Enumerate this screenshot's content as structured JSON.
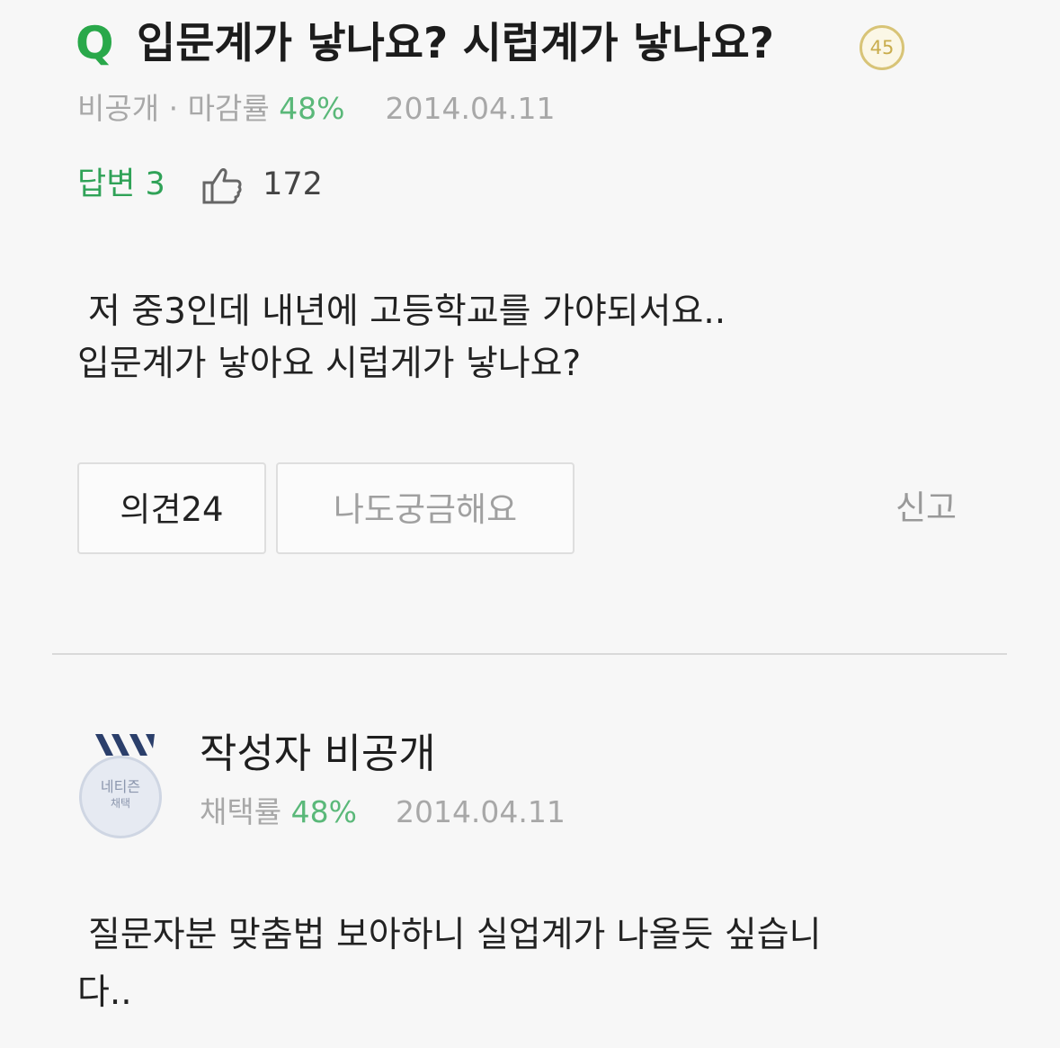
{
  "question": {
    "icon": "Q",
    "title": "입문계가 낳나요? 시럽계가 낳나요?",
    "badge": "45",
    "meta": {
      "visibility": "비공개",
      "separator": "·",
      "close_rate_label": "마감률",
      "close_rate_value": "48%",
      "date": "2014.04.11"
    },
    "stats": {
      "answers": "답변 3",
      "likes": "172"
    },
    "body_line1": "저 중3인데 내년에 고등학교를 가야되서요..",
    "body_line2": "입문계가 낳아요 시럽게가 낳나요?"
  },
  "actions": {
    "opinion_label": "의견24",
    "curious_label": "나도궁금해요",
    "report_label": "신고"
  },
  "answer": {
    "medal_line1": "네티즌",
    "medal_line2": "채택",
    "author": "작성자 비공개",
    "meta": {
      "adopt_rate_label": "채택률",
      "adopt_rate_value": "48%",
      "date": "2014.04.11"
    },
    "body_line1": "질문자분 맞춤법 보아하니 실업계가 나올듯 싶습니",
    "body_line2": "다.."
  },
  "colors": {
    "accent_green": "#29a84a",
    "badge_gold": "#c9ad4d",
    "muted_gray": "#a8a8a8"
  },
  "icons": [
    "q-icon",
    "thumbs-up-icon",
    "medal-icon"
  ]
}
